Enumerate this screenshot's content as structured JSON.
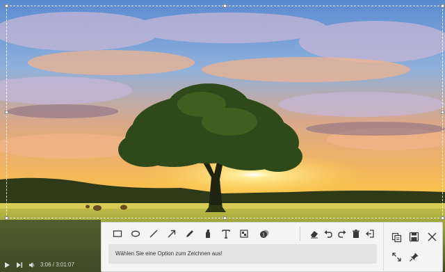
{
  "toolbar": {
    "tools": [
      {
        "name": "rectangle-tool",
        "icon": "rectangle-icon"
      },
      {
        "name": "ellipse-tool",
        "icon": "ellipse-icon"
      },
      {
        "name": "line-tool",
        "icon": "line-icon"
      },
      {
        "name": "arrow-tool",
        "icon": "arrow-icon"
      },
      {
        "name": "pen-tool",
        "icon": "pen-icon"
      },
      {
        "name": "marker-tool",
        "icon": "marker-icon"
      },
      {
        "name": "text-tool",
        "icon": "text-icon"
      },
      {
        "name": "mosaic-tool",
        "icon": "mosaic-icon"
      },
      {
        "name": "number-tool",
        "icon": "numbered-badge-icon"
      },
      {
        "name": "eraser-tool",
        "icon": "eraser-icon"
      },
      {
        "name": "undo-button",
        "icon": "undo-icon"
      },
      {
        "name": "redo-button",
        "icon": "redo-icon"
      },
      {
        "name": "delete-button",
        "icon": "trash-icon"
      },
      {
        "name": "exit-button",
        "icon": "exit-icon"
      }
    ],
    "hint_text": "Wählen Sie eine Option zum Zeichnen aus!",
    "side_actions": [
      {
        "name": "copy-button",
        "icon": "copy-icon"
      },
      {
        "name": "save-button",
        "icon": "save-icon"
      },
      {
        "name": "close-button",
        "icon": "close-icon"
      },
      {
        "name": "expand-button",
        "icon": "expand-icon"
      },
      {
        "name": "pin-button",
        "icon": "pin-icon"
      }
    ]
  },
  "player": {
    "time": "3:06 / 3:01:07"
  },
  "colors": {
    "panel_bg": "#f4f4f4",
    "hint_bg": "#e3e3e3",
    "icon": "#3a3a3a"
  }
}
